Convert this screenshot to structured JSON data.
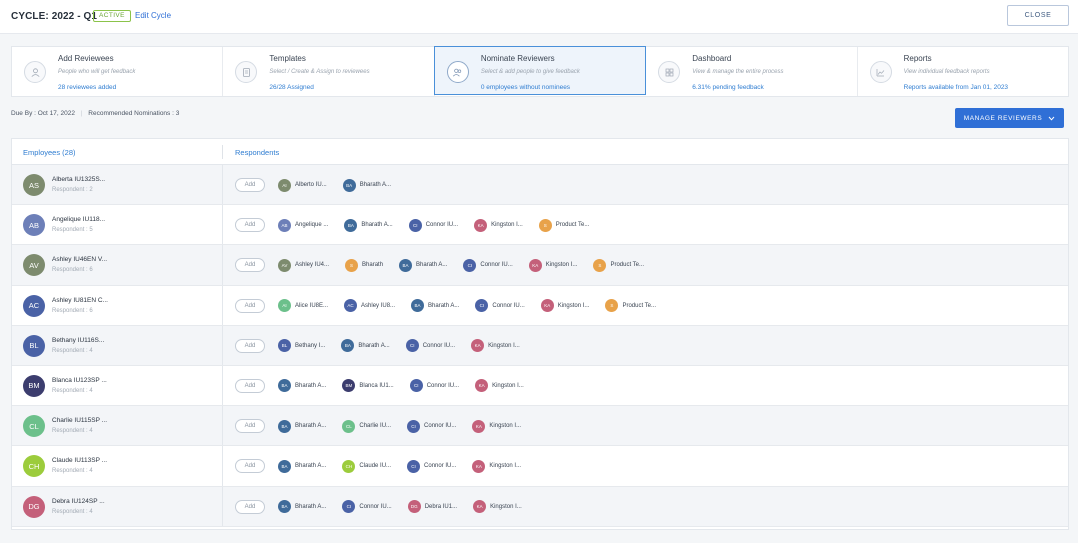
{
  "header": {
    "cycle_title": "CYCLE: 2022 - Q1",
    "status_badge": "ACTIVE",
    "edit_label": "Edit Cycle",
    "close_label": "CLOSE"
  },
  "steps": [
    {
      "title": "Add Reviewees",
      "desc": "People who will get feedback",
      "status": "28 reviewees added",
      "icon": "user-icon",
      "active": false
    },
    {
      "title": "Templates",
      "desc": "Select / Create & Assign to reviewees",
      "status": "26/28 Assigned",
      "icon": "document-icon",
      "active": false
    },
    {
      "title": "Nominate Reviewers",
      "desc": "Select & add people to give feedback",
      "status": "0 employees without nominees",
      "icon": "users-icon",
      "active": true
    },
    {
      "title": "Dashboard",
      "desc": "View & manage the entire process",
      "status": "6.31% pending feedback",
      "icon": "grid-icon",
      "active": false
    },
    {
      "title": "Reports",
      "desc": "View individual feedback reports",
      "status": "Reports available from Jan 01, 2023",
      "icon": "chart-icon",
      "active": false
    }
  ],
  "meta": {
    "due_by": "Due By : Oct 17, 2022",
    "recommended": "Recommended Nominations : 3"
  },
  "manage_btn": "MANAGE REVIEWERS",
  "table": {
    "col_employees": "Employees (28)",
    "col_respondents": "Respondents",
    "add_label": "Add",
    "rows": [
      {
        "initials": "AS",
        "color": "#7d8b6e",
        "name": "Alberta IU1325S...",
        "respondents": "Respondent : 2",
        "chips": [
          {
            "i": "AI",
            "c": "#7d8b6e",
            "n": "Alberto IU..."
          },
          {
            "i": "BA",
            "c": "#3f6b9a",
            "n": "Bharath A..."
          }
        ]
      },
      {
        "initials": "AB",
        "color": "#6d7fb8",
        "name": "Angelique IU118...",
        "respondents": "Respondent : 5",
        "chips": [
          {
            "i": "AB",
            "c": "#6d7fb8",
            "n": "Angelique ..."
          },
          {
            "i": "BA",
            "c": "#3f6b9a",
            "n": "Bharath A..."
          },
          {
            "i": "CI",
            "c": "#4a62a6",
            "n": "Connor IU..."
          },
          {
            "i": "KA",
            "c": "#c4607a",
            "n": "Kingston I..."
          },
          {
            "i": "S",
            "c": "#e8a24a",
            "n": "Product Te..."
          }
        ]
      },
      {
        "initials": "AV",
        "color": "#7d8b6e",
        "name": "Ashley IU46EN V...",
        "respondents": "Respondent : 6",
        "chips": [
          {
            "i": "AV",
            "c": "#7d8b6e",
            "n": "Ashley IU4..."
          },
          {
            "i": "S",
            "c": "#e8a24a",
            "n": "Bharath"
          },
          {
            "i": "BA",
            "c": "#3f6b9a",
            "n": "Bharath A..."
          },
          {
            "i": "CI",
            "c": "#4a62a6",
            "n": "Connor IU..."
          },
          {
            "i": "KA",
            "c": "#c4607a",
            "n": "Kingston I..."
          },
          {
            "i": "S",
            "c": "#e8a24a",
            "n": "Product Te..."
          }
        ]
      },
      {
        "initials": "AC",
        "color": "#4a62a6",
        "name": "Ashley IU81EN C...",
        "respondents": "Respondent : 6",
        "chips": [
          {
            "i": "AI",
            "c": "#6cc08b",
            "n": "Alice IU8E..."
          },
          {
            "i": "AC",
            "c": "#4a62a6",
            "n": "Ashley IU8..."
          },
          {
            "i": "BA",
            "c": "#3f6b9a",
            "n": "Bharath A..."
          },
          {
            "i": "CI",
            "c": "#4a62a6",
            "n": "Connor IU..."
          },
          {
            "i": "KA",
            "c": "#c4607a",
            "n": "Kingston I..."
          },
          {
            "i": "S",
            "c": "#e8a24a",
            "n": "Product Te..."
          }
        ]
      },
      {
        "initials": "BL",
        "color": "#4a62a6",
        "name": "Bethany IU116S...",
        "respondents": "Respondent : 4",
        "chips": [
          {
            "i": "BL",
            "c": "#4a62a6",
            "n": "Bethany I..."
          },
          {
            "i": "BA",
            "c": "#3f6b9a",
            "n": "Bharath A..."
          },
          {
            "i": "CI",
            "c": "#4a62a6",
            "n": "Connor IU..."
          },
          {
            "i": "KA",
            "c": "#c4607a",
            "n": "Kingston I..."
          }
        ]
      },
      {
        "initials": "BM",
        "color": "#3c3d6e",
        "name": "Blanca IU123SP ...",
        "respondents": "Respondent : 4",
        "chips": [
          {
            "i": "BA",
            "c": "#3f6b9a",
            "n": "Bharath A..."
          },
          {
            "i": "BM",
            "c": "#3c3d6e",
            "n": "Blanca IU1..."
          },
          {
            "i": "CI",
            "c": "#4a62a6",
            "n": "Connor IU..."
          },
          {
            "i": "KA",
            "c": "#c4607a",
            "n": "Kingston I..."
          }
        ]
      },
      {
        "initials": "CL",
        "color": "#6cc08b",
        "name": "Charlie IU115SP ...",
        "respondents": "Respondent : 4",
        "chips": [
          {
            "i": "BA",
            "c": "#3f6b9a",
            "n": "Bharath A..."
          },
          {
            "i": "CL",
            "c": "#6cc08b",
            "n": "Charlie IU..."
          },
          {
            "i": "CI",
            "c": "#4a62a6",
            "n": "Connor IU..."
          },
          {
            "i": "KA",
            "c": "#c4607a",
            "n": "Kingston I..."
          }
        ]
      },
      {
        "initials": "CH",
        "color": "#9ccc3c",
        "name": "Claude IU113SP ...",
        "respondents": "Respondent : 4",
        "chips": [
          {
            "i": "BA",
            "c": "#3f6b9a",
            "n": "Bharath A..."
          },
          {
            "i": "CH",
            "c": "#9ccc3c",
            "n": "Claude IU..."
          },
          {
            "i": "CI",
            "c": "#4a62a6",
            "n": "Connor IU..."
          },
          {
            "i": "KA",
            "c": "#c4607a",
            "n": "Kingston I..."
          }
        ]
      },
      {
        "initials": "DG",
        "color": "#c4607a",
        "name": "Debra IU124SP ...",
        "respondents": "Respondent : 4",
        "chips": [
          {
            "i": "BA",
            "c": "#3f6b9a",
            "n": "Bharath A..."
          },
          {
            "i": "CI",
            "c": "#4a62a6",
            "n": "Connor IU..."
          },
          {
            "i": "DG",
            "c": "#c4607a",
            "n": "Debra IU1..."
          },
          {
            "i": "KA",
            "c": "#c4607a",
            "n": "Kingston I..."
          }
        ]
      }
    ]
  }
}
